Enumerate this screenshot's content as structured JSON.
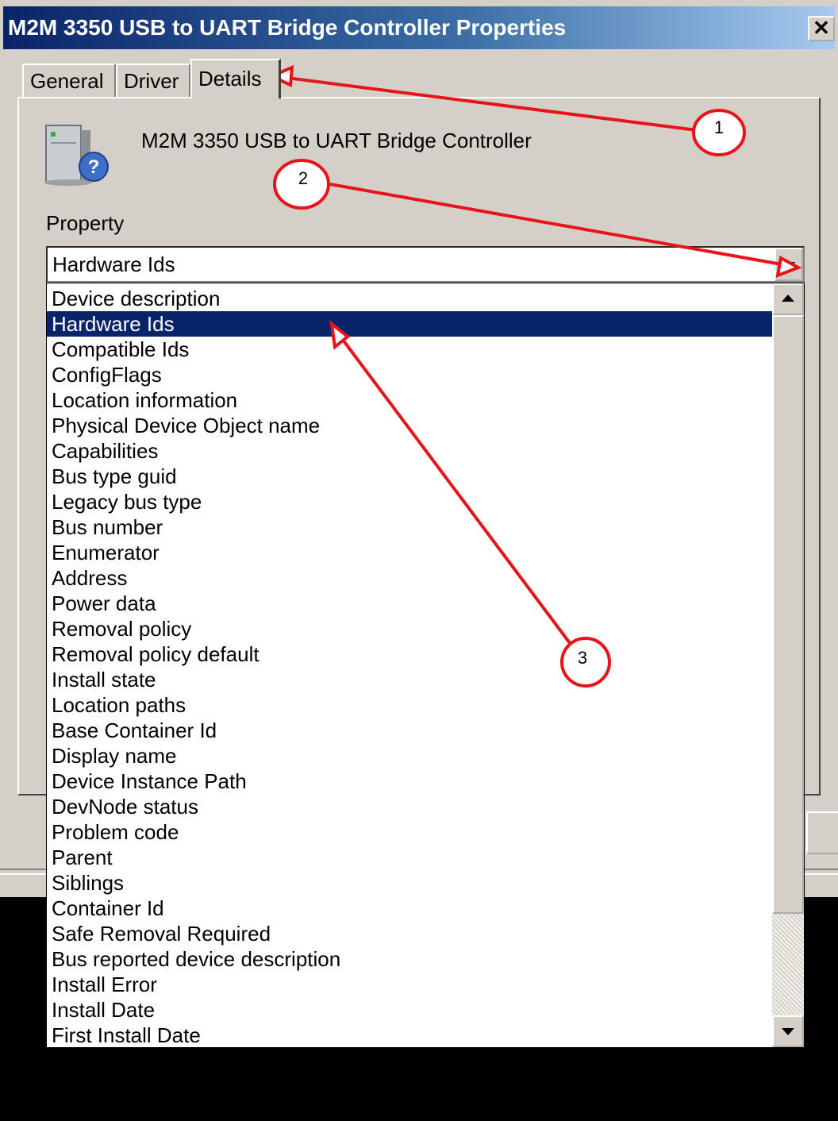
{
  "window": {
    "title": "M2M 3350 USB to UART Bridge Controller Properties",
    "close_glyph": "✕"
  },
  "tabs": [
    {
      "label": "General"
    },
    {
      "label": "Driver"
    },
    {
      "label": "Details",
      "active": true
    }
  ],
  "device": {
    "icon": "device-unknown-icon",
    "name": "M2M 3350 USB to UART Bridge Controller"
  },
  "property": {
    "label": "Property",
    "selected": "Hardware Ids",
    "options": [
      "Device description",
      "Hardware Ids",
      "Compatible Ids",
      "ConfigFlags",
      "Location information",
      "Physical Device Object name",
      "Capabilities",
      "Bus type guid",
      "Legacy bus type",
      "Bus number",
      "Enumerator",
      "Address",
      "Power data",
      "Removal policy",
      "Removal policy default",
      "Install state",
      "Location paths",
      "Base Container Id",
      "Display name",
      "Device Instance Path",
      "DevNode status",
      "Problem code",
      "Parent",
      "Siblings",
      "Container Id",
      "Safe Removal Required",
      "Bus reported device description",
      "Install Error",
      "Install Date",
      "First Install Date"
    ]
  },
  "annotations": {
    "color": "#e8141c",
    "callouts": [
      "1",
      "2",
      "3"
    ]
  }
}
